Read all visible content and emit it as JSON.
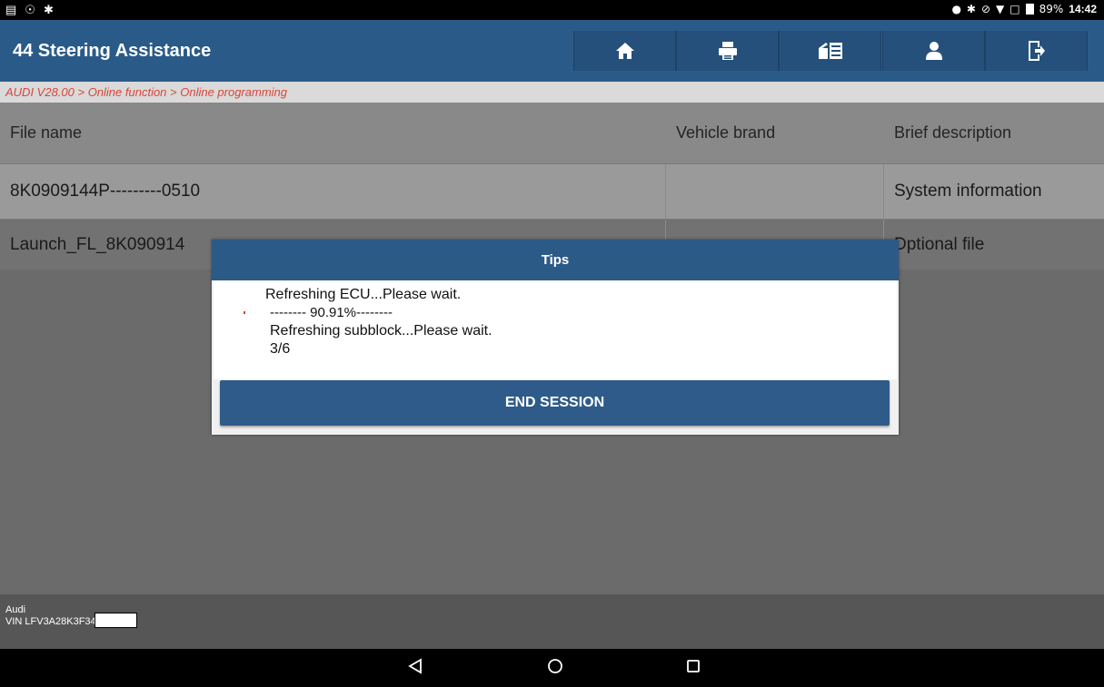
{
  "status_bar": {
    "battery": "89%",
    "time": "14:42"
  },
  "header": {
    "title": "44 Steering Assistance",
    "icons": [
      "home-icon",
      "print-icon",
      "report-icon",
      "user-icon",
      "exit-icon"
    ]
  },
  "breadcrumb": "AUDI V28.00 > Online function > Online programming",
  "table": {
    "columns": [
      "File name",
      "Vehicle brand",
      "Brief description"
    ],
    "rows": [
      {
        "file_name": "8K0909144P---------0510",
        "brand": "",
        "description": "System information"
      },
      {
        "file_name": "Launch_FL_8K090914",
        "brand": "",
        "description": "Dptional file"
      }
    ]
  },
  "dialog": {
    "title": "Tips",
    "lines": [
      "Refreshing ECU...Please wait.",
      "-------- 90.91%--------",
      "Refreshing subblock...Please wait.",
      "3/6"
    ],
    "button": "END SESSION"
  },
  "footer": {
    "make": "Audi",
    "vin": "VIN LFV3A28K3F34"
  },
  "colors": {
    "header_bg": "#2a5a88",
    "breadcrumb_text": "#d9453a",
    "button_bg": "#2e5b89"
  }
}
